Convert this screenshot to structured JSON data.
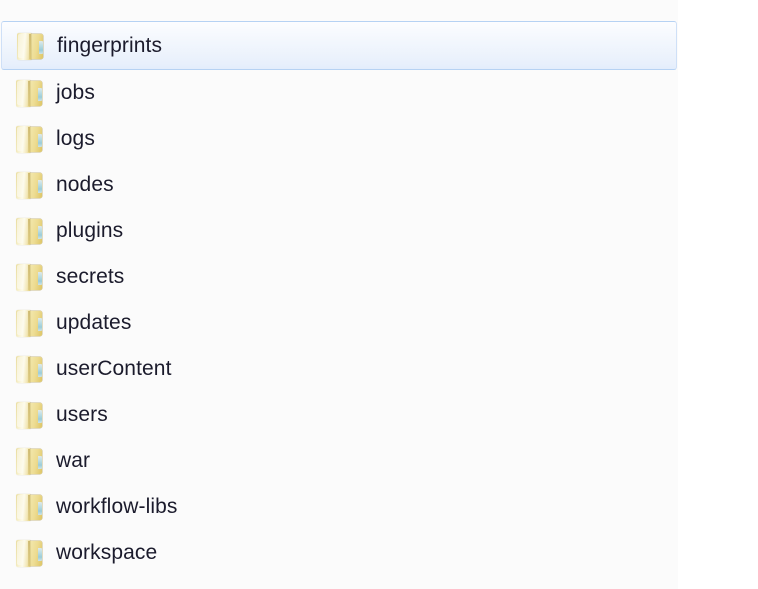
{
  "window": {
    "view_mode": "list",
    "pane_background": "#fbfbfb",
    "outside_background": "#ffffff",
    "selection_accent": "#b6d2f3",
    "text_color": "#1b1b2c"
  },
  "file_list": {
    "selected_index": 0,
    "items": [
      {
        "name": "fingerprints",
        "icon": "folder-icon",
        "type": "folder",
        "selected": true
      },
      {
        "name": "jobs",
        "icon": "folder-icon",
        "type": "folder",
        "selected": false
      },
      {
        "name": "logs",
        "icon": "folder-icon",
        "type": "folder",
        "selected": false
      },
      {
        "name": "nodes",
        "icon": "folder-icon",
        "type": "folder",
        "selected": false
      },
      {
        "name": "plugins",
        "icon": "folder-icon",
        "type": "folder",
        "selected": false
      },
      {
        "name": "secrets",
        "icon": "folder-icon",
        "type": "folder",
        "selected": false
      },
      {
        "name": "updates",
        "icon": "folder-icon",
        "type": "folder",
        "selected": false
      },
      {
        "name": "userContent",
        "icon": "folder-icon",
        "type": "folder",
        "selected": false
      },
      {
        "name": "users",
        "icon": "folder-icon",
        "type": "folder",
        "selected": false
      },
      {
        "name": "war",
        "icon": "folder-icon",
        "type": "folder",
        "selected": false
      },
      {
        "name": "workflow-libs",
        "icon": "folder-icon",
        "type": "folder",
        "selected": false
      },
      {
        "name": "workspace",
        "icon": "folder-icon",
        "type": "folder",
        "selected": false
      }
    ]
  }
}
